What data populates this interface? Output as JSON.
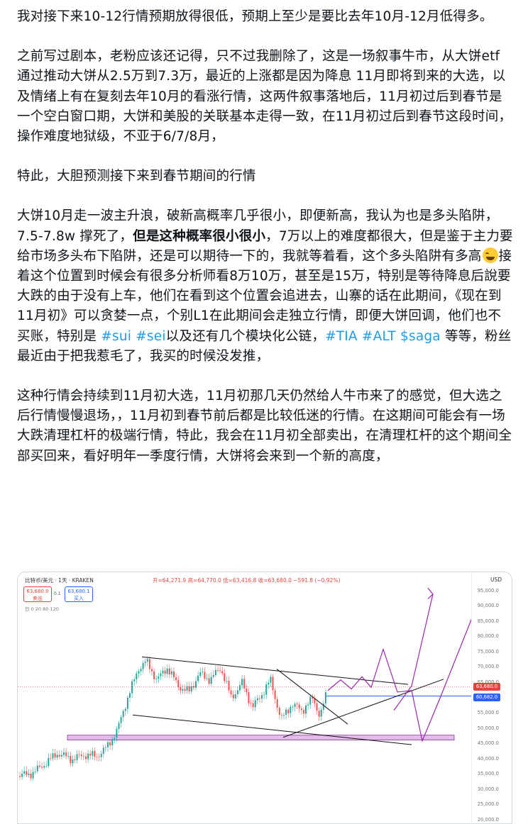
{
  "post": {
    "p1": "我对接下来10-12行情预期放得很低，预期上至少是要比去年10月-12月低得多。",
    "p2": "之前写过剧本，老粉应该还记得，只不过我删除了，这是一场叙事牛市，从大饼etf 通过推动大饼从2.5万到7.3万，最近的上涨都是因为降息 11月即将到来的大选，以及情绪上有在复刻去年10月的看涨行情，这两件叙事落地后，11月初过后到春节是一个空白窗口期，大饼和美股的关联基本走得一致，在11月初过后到春节这段时间，操作难度地狱级，不亚于6/7/8月，",
    "p3": "特此，大胆预测接下来到春节期间的行情",
    "p4a": "大饼10月走一波主升浪，破新高概率几乎很小，即便新高，我认为也是多头陷阱，7.5-7.8w 撑死了，",
    "p4b": "但是这种概率很小很小",
    "p4c": "，7万以上的难度都很大，但是鉴于主力要给市场多头布下陷阱，还是可以期待一下的，我就等着看，这个多头陷阱有多高",
    "p4d": "接着这个位置到时候会有很多分析师看8万10万，甚至是15万，特别是等待降息后說要大跌的由于没有上车，他们在看到这个位置会追进去，山寨的话在此期间，《现在到11月初》可以贪婪一点，个别L1在此期间会走独立行情，即便大饼回调，他们也不买账，特别是",
    "tag_sui": "#sui",
    "tag_sei": "#sei",
    "p4e": "以及还有几个模块化公链，",
    "tag_tia": "#TIA",
    "tag_alt": "#ALT",
    "tag_saga": "$saga",
    "p4f": "等等，粉丝最近由于把我惹毛了，我买的时候没发推，",
    "p5": "这种行情会持续到11月初大选，11月初那几天仍然给人牛市来了的感觉，但大选之后行情慢慢退场，，11月初到春节前后都是比较低迷的行情。在这期间可能会有一场大跌清理杠杆的极端行情，特此，我会在11月初全部卖出，在清理杠杆的这个期间全部买回来，看好明年一季度行情，大饼将会来到一个新的高度，",
    "emoji": "joy-emoji"
  },
  "chart": {
    "symbol": "比特币/美元 · 1天 · KRAKEN",
    "ohlc": "开=64,271.9  高=64,770.0  低=63,416.8  收=63,680.0  −591.8 (−0.92%)",
    "currency": "USD",
    "sell_price": "63,680.0",
    "sell_label": "卖出",
    "buy_price": "63,680.1",
    "buy_label": "买入",
    "spread": "0.1",
    "volume": "日 0 20 80 120",
    "price_label_last": "63,680.0",
    "price_label_line": "60,682.0",
    "accent_up": "#26a69a",
    "accent_down": "#ef5350",
    "draw_color": "#9c27b0"
  },
  "chart_data": {
    "type": "candlestick",
    "yaxis_ticks": [
      "95,000.0",
      "90,000.0",
      "85,000.0",
      "80,000.0",
      "75,000.0",
      "70,000.0",
      "65,000.0",
      "60,000.0",
      "55,000.0",
      "50,000.0",
      "45,000.0",
      "40,000.0",
      "35,000.0",
      "30,000.0",
      "25,000.0",
      "20,000.0"
    ],
    "ylim": [
      20000,
      97000
    ],
    "last_price": 63680.0,
    "horizontal_line": 60682.0
  }
}
